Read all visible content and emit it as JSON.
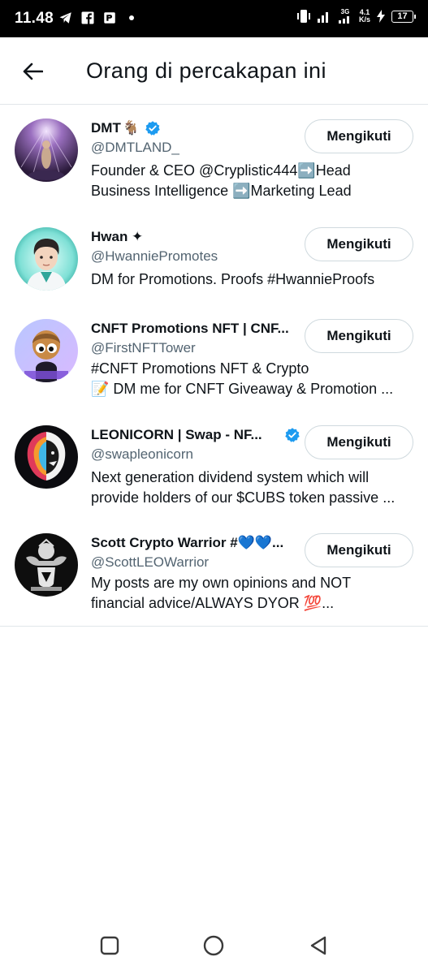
{
  "status_bar": {
    "time": "11.48",
    "network_type": "3G",
    "speed_value": "4.1",
    "speed_unit": "K/s",
    "battery": "17"
  },
  "header": {
    "title": "Orang di percakapan ini"
  },
  "users": [
    {
      "name": "DMT",
      "name_suffix": "🐐",
      "verified": true,
      "handle": "@DMTLAND_",
      "bio": [
        "Founder & CEO @Cryplistic444➡️Head",
        "Business Intelligence ➡️Marketing Lead"
      ],
      "button": "Mengikuti"
    },
    {
      "name": "Hwan ✦",
      "name_suffix": "",
      "verified": false,
      "handle": "@HwanniePromotes",
      "bio": [
        "DM for Promotions. Proofs #HwannieProofs"
      ],
      "button": "Mengikuti"
    },
    {
      "name": "CNFT Promotions NFT | CNF...",
      "name_suffix": "",
      "verified": false,
      "handle": "@FirstNFTTower",
      "bio": [
        "#CNFT Promotions NFT & Crypto",
        "📝 DM me for CNFT Giveaway & Promotion ..."
      ],
      "button": "Mengikuti"
    },
    {
      "name": "LEONICORN | Swap - NF...",
      "name_suffix": "",
      "verified": true,
      "handle": "@swapleonicorn",
      "bio": [
        "Next generation dividend system which will",
        "provide holders of our $CUBS token passive ..."
      ],
      "button": "Mengikuti"
    },
    {
      "name": "Scott Crypto Warrior #💙💙...",
      "name_suffix": "",
      "verified": false,
      "handle": "@ScottLEOWarrior",
      "bio": [
        "My posts are my own opinions and NOT",
        "financial advice/ALWAYS DYOR 💯..."
      ],
      "button": "Mengikuti"
    }
  ],
  "icons": {
    "back": "arrow-left-icon",
    "verified": "verified-badge-icon",
    "nav_recents": "square-icon",
    "nav_home": "circle-icon",
    "nav_back": "triangle-back-icon"
  },
  "colors": {
    "verified_blue": "#1d9bf0",
    "text_primary": "#0f1419",
    "text_secondary": "#536471",
    "border": "#cfd9de"
  }
}
